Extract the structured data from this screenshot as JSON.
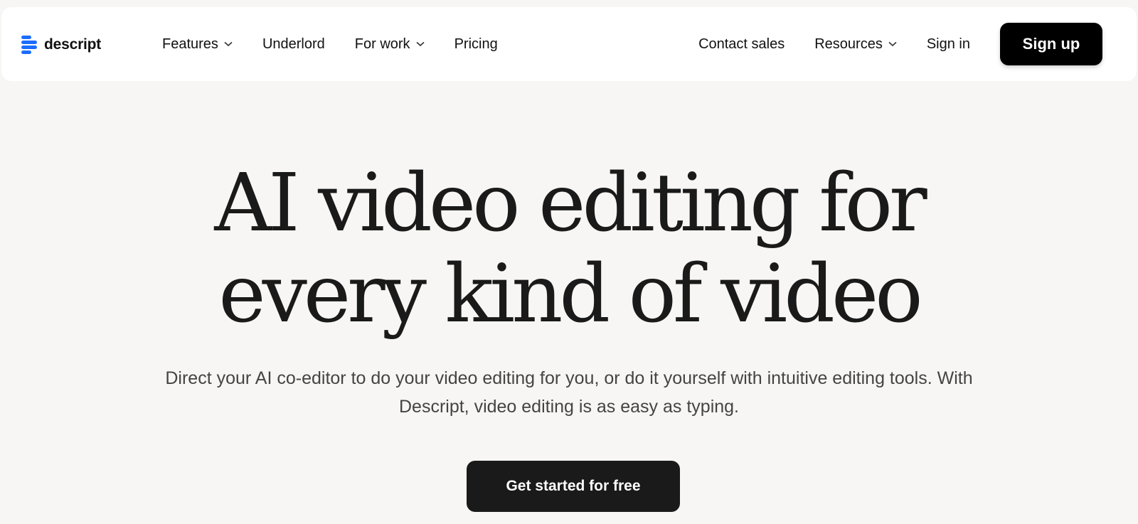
{
  "brand": {
    "name": "descript",
    "color": "#1b6dff"
  },
  "nav": {
    "left": [
      {
        "label": "Features",
        "dropdown": true
      },
      {
        "label": "Underlord",
        "dropdown": false
      },
      {
        "label": "For work",
        "dropdown": true
      },
      {
        "label": "Pricing",
        "dropdown": false
      }
    ],
    "right": [
      {
        "label": "Contact sales",
        "dropdown": false
      },
      {
        "label": "Resources",
        "dropdown": true
      },
      {
        "label": "Sign in",
        "dropdown": false
      }
    ],
    "signup_label": "Sign up"
  },
  "hero": {
    "title_line1": "AI video editing for",
    "title_line2": "every kind of video",
    "subtitle": "Direct your AI co-editor to do your video editing for you, or do it yourself with intuitive editing tools. With Descript, video editing is as easy as typing.",
    "cta_label": "Get started for free"
  }
}
